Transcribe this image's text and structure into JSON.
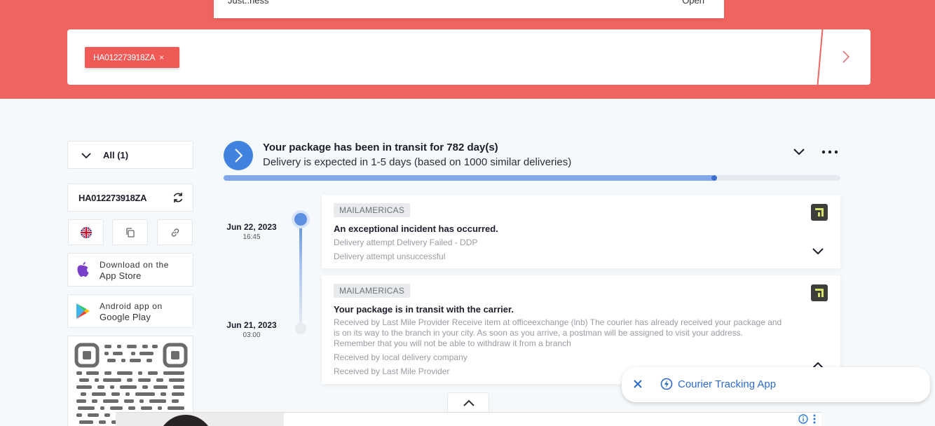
{
  "top_dropdown": {
    "left_label": "Just..ness",
    "right_label": "Open"
  },
  "search": {
    "tag_value": "HA012273918ZA",
    "tag_remove_symbol": "×"
  },
  "sidebar": {
    "filter_label": "All (1)",
    "tracking_number": "HA012273918ZA",
    "app_store": {
      "line1": "Download on the",
      "line2": "App Store"
    },
    "google_play": {
      "line1": "Android app on",
      "line2": "Google Play"
    }
  },
  "status": {
    "title": "Your package has been in transit for 782 day(s)",
    "subtitle": "Delivery is expected in 1-5 days (based on 1000 similar deliveries)",
    "progress": 0.795,
    "accent_color": "#3f82e0",
    "brand_color": "#f06460"
  },
  "events": [
    {
      "date": "Jun 22, 2023",
      "time": "16:45",
      "carrier": "MAILAMERICAS",
      "title": "An exceptional incident has occurred.",
      "lines": [
        "Delivery attempt Delivery Failed - DDP",
        "Delivery attempt unsuccessful"
      ]
    },
    {
      "date": "Jun 21, 2023",
      "time": "03:00",
      "carrier": "MAILAMERICAS",
      "title": "Your package is in transit with the carrier.",
      "lines": [
        "Received by Last Mile Provider Receive item at officeexchange (lnb) The courier has already received your package and is on its way to the branch in your city. As soon as you arrive, a postman will be assigned to visit your address. Remember that you will not be able to withdraw it from a branch",
        "Received by local delivery company",
        "Received by Last Mile Provider"
      ]
    }
  ],
  "toast": {
    "label": "Courier Tracking App"
  },
  "icons": {
    "filter": "chevron-down-icon",
    "refresh": "refresh-icon",
    "language": "uk-flag-icon",
    "copy": "copy-icon",
    "link": "link-icon",
    "apple": "apple-icon",
    "play": "google-play-icon",
    "carrier_logo": "carrier-logo-icon",
    "bolt": "bolt-icon"
  }
}
